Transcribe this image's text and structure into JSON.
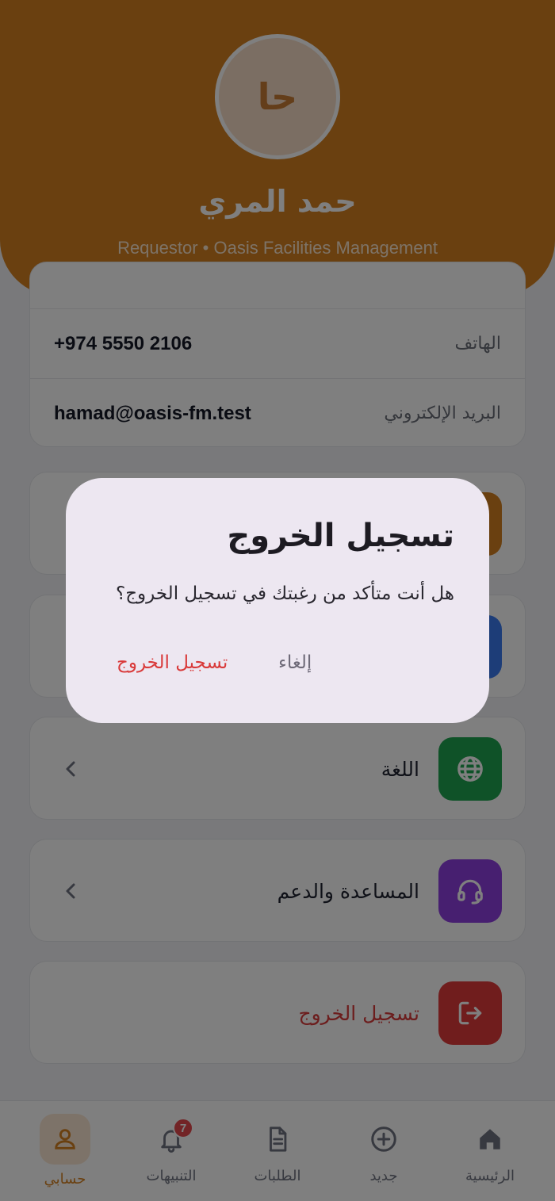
{
  "profile": {
    "initials": "حا",
    "name": "حمد المري",
    "role_line": "Requestor • Oasis Facilities Management"
  },
  "info": [
    {
      "label": "الهاتف",
      "value": "+974 5550 2106"
    },
    {
      "label": "البريد الإلكتروني",
      "value": "hamad@oasis-fm.test"
    }
  ],
  "menu": {
    "language_label": "اللغة",
    "support_label": "المساعدة والدعم",
    "logout_label": "تسجيل الخروج"
  },
  "dialog": {
    "title": "تسجيل الخروج",
    "message": "هل أنت متأكد من رغبتك في تسجيل الخروج؟",
    "cancel_label": "إلغاء",
    "confirm_label": "تسجيل الخروج"
  },
  "nav": {
    "home": "الرئيسية",
    "new": "جديد",
    "requests": "الطلبات",
    "notifications": "التنبيهات",
    "notifications_badge": "7",
    "account": "حسابي"
  },
  "colors": {
    "brand": "#d58121",
    "language_icon_bg": "#1fa550",
    "support_icon_bg": "#8f3fe0",
    "logout_icon_bg": "#e03a3a",
    "blue_icon_bg": "#3b7bf0",
    "danger": "#d93a3a"
  },
  "icons": {
    "language": "globe-icon",
    "support": "headset-icon",
    "logout": "logout-icon",
    "chevron": "chevron-left-icon",
    "home": "home-icon",
    "new": "plus-circle-icon",
    "requests": "document-icon",
    "notifications": "bell-icon",
    "account": "user-icon"
  }
}
